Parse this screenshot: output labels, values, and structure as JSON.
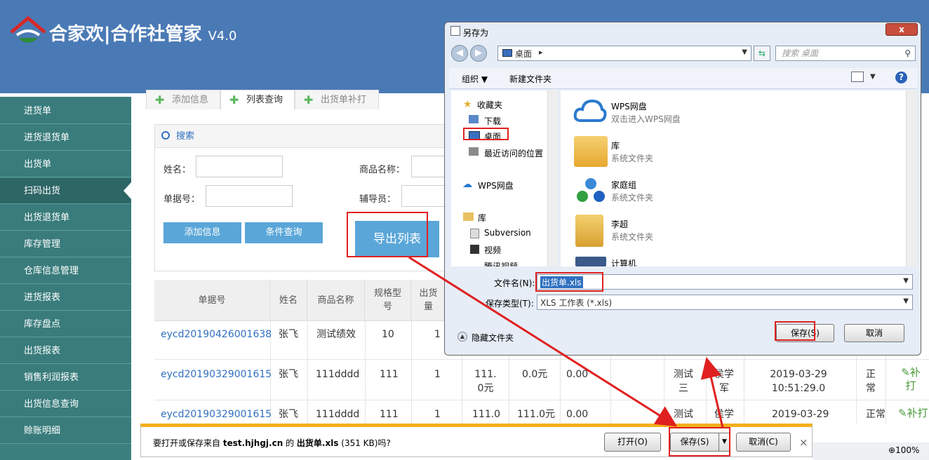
{
  "app": {
    "title": "合家欢|合作社管家",
    "version": "V4.0"
  },
  "sidebar": {
    "items": [
      {
        "label": "进货单"
      },
      {
        "label": "进货退货单"
      },
      {
        "label": "出货单"
      },
      {
        "label": "扫码出货"
      },
      {
        "label": "出货退货单"
      },
      {
        "label": "库存管理"
      },
      {
        "label": "仓库信息管理"
      },
      {
        "label": "进货报表"
      },
      {
        "label": "库存盘点"
      },
      {
        "label": "出货报表"
      },
      {
        "label": "销售利润报表"
      },
      {
        "label": "出货信息查询"
      },
      {
        "label": "赊账明细"
      }
    ],
    "active_index": 3
  },
  "tabs": [
    {
      "label": "添加信息"
    },
    {
      "label": "列表查询"
    },
    {
      "label": "出货单补打"
    }
  ],
  "search": {
    "title": "搜索",
    "name_label": "姓名：",
    "product_label": "商品名称：",
    "doc_label": "单据号：",
    "guide_label": "辅导员：",
    "add_button": "添加信息",
    "query_button": "条件查询",
    "export_button": "导出列表"
  },
  "table": {
    "headers": [
      "单据号",
      "姓名",
      "商品名称",
      "规格型号",
      "出货量"
    ],
    "rows": [
      {
        "doc": "eycd20190426001638",
        "name": "张飞",
        "product": "测试绩效",
        "spec": "10",
        "qty": "1"
      },
      {
        "doc": "eycd20190329001615",
        "name": "张飞",
        "product": "111dddd",
        "spec": "111",
        "qty": "1",
        "price": "111.0元",
        "amount": "0.0元",
        "extra": "0.00",
        "guide": "测试三",
        "person": "侯学军",
        "time": "2019-03-29 10:51:29.0",
        "status": "正常",
        "action": "补打"
      },
      {
        "doc": "eycd20190329001615",
        "name": "张飞",
        "product": "111dddd",
        "spec": "111",
        "qty": "1",
        "price": "111.0",
        "amount": "111.0元",
        "extra": "0.00",
        "guide": "测试",
        "person": "侯学",
        "time": "2019-03-29",
        "status": "正常",
        "action": "补打"
      }
    ]
  },
  "dialog": {
    "title": "另存为",
    "close": "x",
    "address": "桌面",
    "search_placeholder": "搜索 桌面",
    "organize": "组织 ▼",
    "new_folder": "新建文件夹",
    "help": "?",
    "nav": {
      "favorites": "收藏夹",
      "downloads": "下载",
      "desktop": "桌面",
      "recent": "最近访问的位置",
      "wps": "WPS网盘",
      "library": "库",
      "subversion": "Subversion",
      "video": "视频",
      "tencent": "腾讯视频"
    },
    "files": [
      {
        "name": "WPS网盘",
        "desc": "双击进入WPS网盘"
      },
      {
        "name": "库",
        "desc": "系统文件夹"
      },
      {
        "name": "家庭组",
        "desc": "系统文件夹"
      },
      {
        "name": "李超",
        "desc": "系统文件夹"
      },
      {
        "name": "计算机",
        "desc": ""
      }
    ],
    "filename_label": "文件名(N):",
    "filename_value": "出货单.xls",
    "filetype_label": "保存类型(T):",
    "filetype_value": "XLS 工作表 (*.xls)",
    "hide_folders": "隐藏文件夹",
    "save": "保存(S)",
    "cancel": "取消"
  },
  "download": {
    "prefix": "要打开或保存来自 ",
    "site": "test.hjhgj.cn",
    "mid": " 的 ",
    "file": "出货单.xls",
    "suffix": " (351 KB)吗?",
    "open": "打开(O)",
    "save": "保存(S)",
    "cancel": "取消(C)",
    "close": "×"
  },
  "status": {
    "zoom": "100%"
  },
  "colors": {
    "header": "#4a7ab5",
    "sidebar": "#3a7c7c",
    "accent": "#5aa6d8",
    "highlight": "#e02020",
    "download_bar": "#f2b01c"
  }
}
